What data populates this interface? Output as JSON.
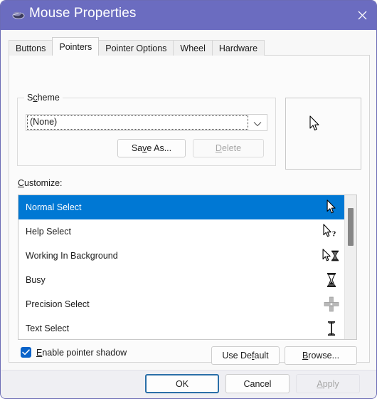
{
  "window": {
    "title": "Mouse Properties",
    "icon": "mouse-icon",
    "close_label": "✕",
    "accent_titlebar": "#6b6cc0",
    "selection_color": "#0078d4",
    "checkbox_color": "#0a63c9",
    "focus_border_color": "#2a6fa8"
  },
  "tabs": [
    {
      "label": "Buttons",
      "active": false
    },
    {
      "label": "Pointers",
      "active": true
    },
    {
      "label": "Pointer Options",
      "active": false
    },
    {
      "label": "Wheel",
      "active": false
    },
    {
      "label": "Hardware",
      "active": false
    }
  ],
  "scheme": {
    "legend_pre": "S",
    "legend_accel": "c",
    "legend_post": "heme",
    "combo_value": "(None)",
    "combo_arrow_icon": "chevron-down-icon",
    "save_as": {
      "pre": "Sa",
      "accel": "v",
      "post": "e As...",
      "enabled": true
    },
    "delete": {
      "pre": "",
      "accel": "D",
      "post": "elete",
      "enabled": false
    }
  },
  "preview": {
    "cursor_icon": "arrow-pointer-icon"
  },
  "customize": {
    "label_pre": "",
    "label_accel": "C",
    "label_post": "ustomize:",
    "items": [
      {
        "label": "Normal Select",
        "icon": "arrow-pointer-icon",
        "selected": true
      },
      {
        "label": "Help Select",
        "icon": "arrow-help-icon",
        "selected": false
      },
      {
        "label": "Working In Background",
        "icon": "arrow-hourglass-icon",
        "selected": false
      },
      {
        "label": "Busy",
        "icon": "hourglass-icon",
        "selected": false
      },
      {
        "label": "Precision Select",
        "icon": "crosshair-icon",
        "selected": false
      },
      {
        "label": "Text Select",
        "icon": "i-beam-icon",
        "selected": false
      }
    ]
  },
  "options": {
    "pointer_shadow": {
      "pre": "",
      "accel": "E",
      "post": "nable pointer shadow",
      "checked": true
    },
    "use_default": {
      "pre": "Use De",
      "accel": "f",
      "post": "ault",
      "enabled": true
    },
    "browse": {
      "pre": "",
      "accel": "B",
      "post": "rowse...",
      "enabled": true
    }
  },
  "footer": {
    "ok": {
      "label": "OK",
      "default": true,
      "enabled": true
    },
    "cancel": {
      "label": "Cancel",
      "default": false,
      "enabled": true
    },
    "apply": {
      "pre": "",
      "accel": "A",
      "post": "pply",
      "enabled": false
    }
  }
}
